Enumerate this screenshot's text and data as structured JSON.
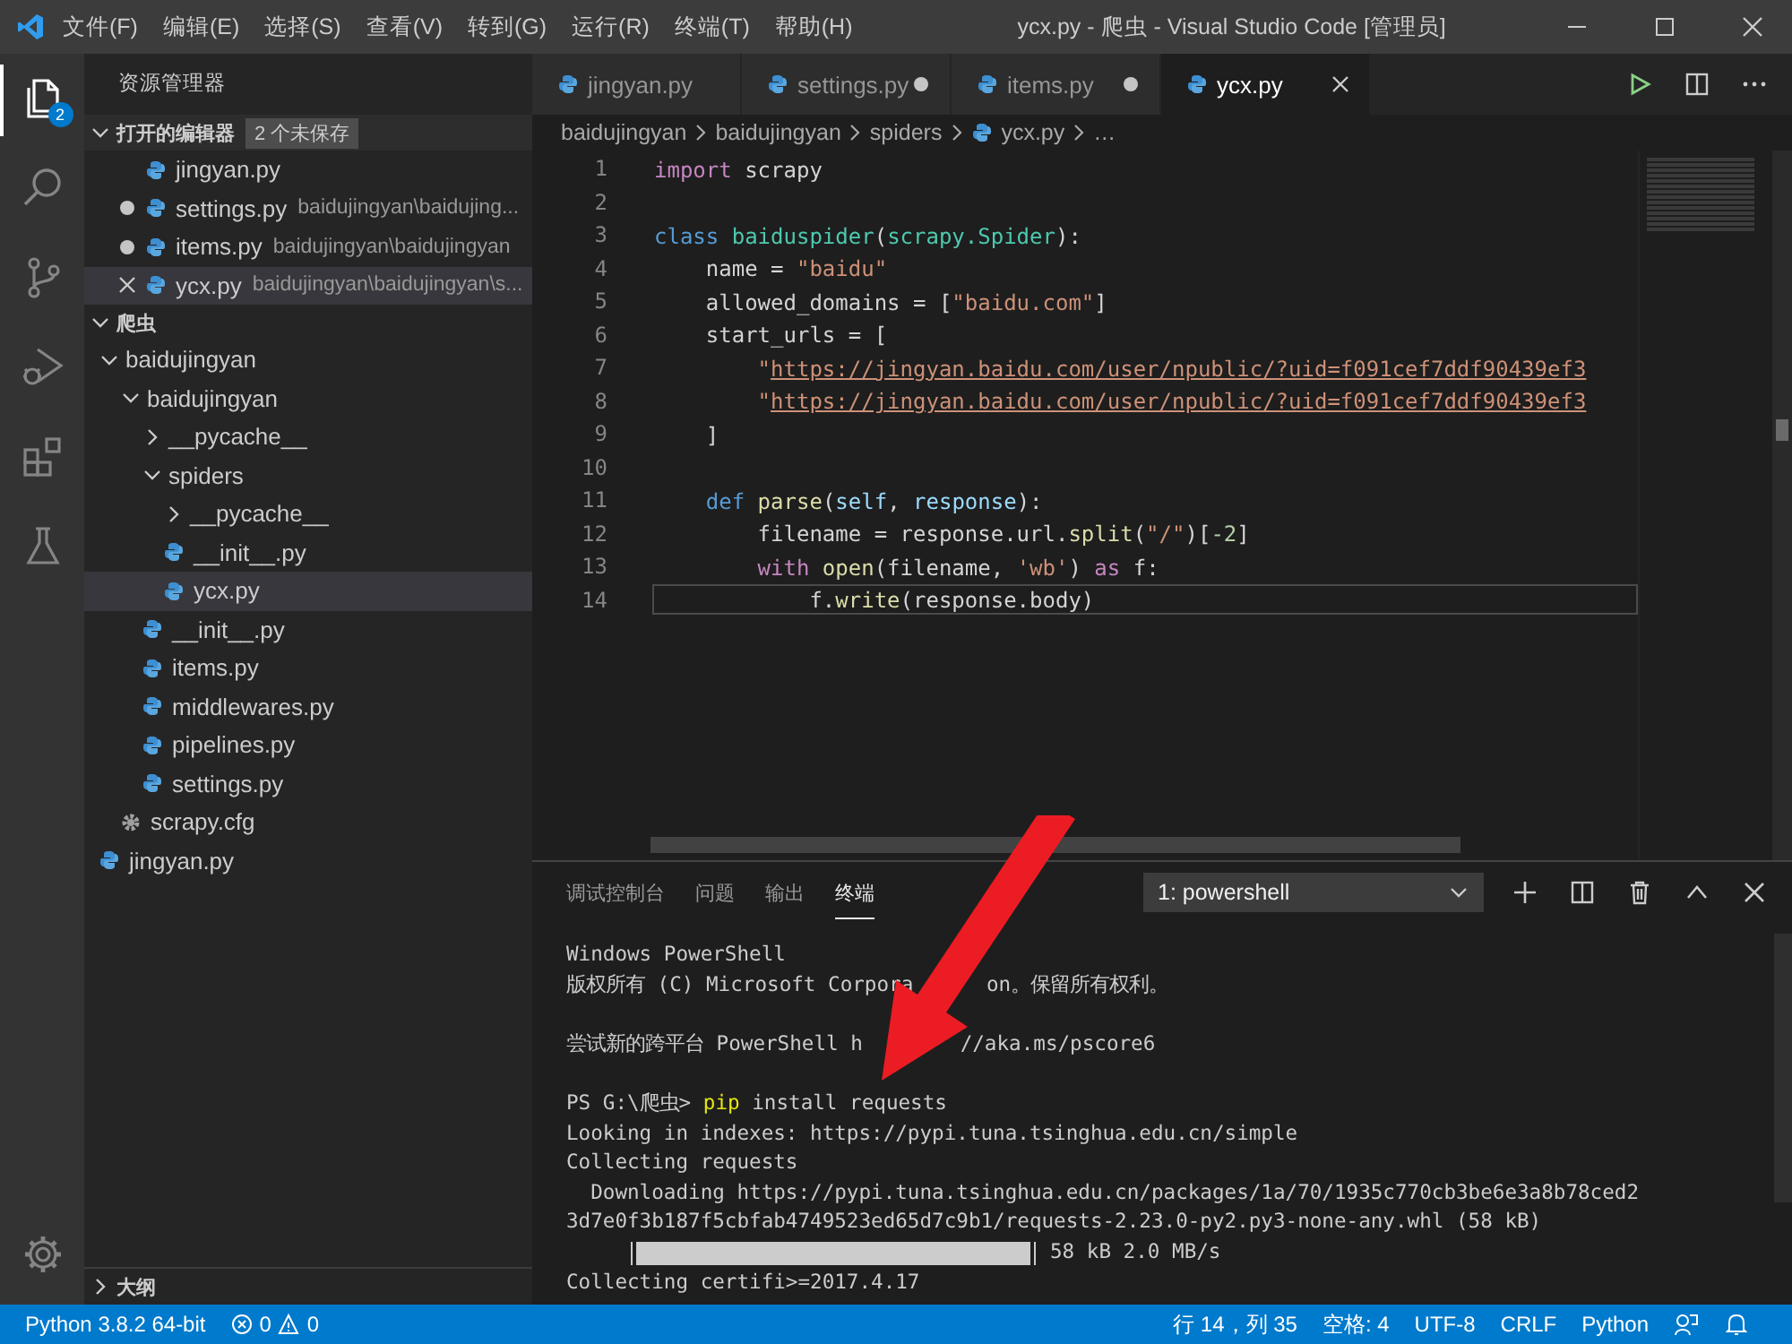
{
  "window": {
    "title": "ycx.py - 爬虫 - Visual Studio Code [管理员]"
  },
  "menu": [
    "文件(F)",
    "编辑(E)",
    "选择(S)",
    "查看(V)",
    "转到(G)",
    "运行(R)",
    "终端(T)",
    "帮助(H)"
  ],
  "activity_bar": {
    "explorer_badge": "2"
  },
  "sidebar": {
    "title": "资源管理器",
    "open_editors": {
      "label": "打开的编辑器",
      "badge": "2 个未保存",
      "expanded": true,
      "items": [
        {
          "label": "jingyan.py",
          "modified": false,
          "selected": false
        },
        {
          "label": "settings.py",
          "path": "baidujingyan\\baidujing...",
          "modified": true,
          "selected": false
        },
        {
          "label": "items.py",
          "path": "baidujingyan\\baidujingyan",
          "modified": true,
          "selected": false
        },
        {
          "label": "ycx.py",
          "path": "baidujingyan\\baidujingyan\\s...",
          "modified": false,
          "selected": true
        }
      ]
    },
    "workspace": {
      "label": "爬虫",
      "expanded": true,
      "tree": [
        {
          "label": "baidujingyan",
          "kind": "folder",
          "expanded": true,
          "selected": false,
          "children": [
            {
              "label": "baidujingyan",
              "kind": "folder",
              "expanded": true,
              "selected": false,
              "children": [
                {
                  "label": "__pycache__",
                  "kind": "folder",
                  "expanded": false,
                  "selected": false
                },
                {
                  "label": "spiders",
                  "kind": "folder",
                  "expanded": true,
                  "selected": false,
                  "children": [
                    {
                      "label": "__pycache__",
                      "kind": "folder",
                      "expanded": false,
                      "selected": false
                    },
                    {
                      "label": "__init__.py",
                      "kind": "python",
                      "selected": false
                    },
                    {
                      "label": "ycx.py",
                      "kind": "python",
                      "selected": true
                    }
                  ]
                },
                {
                  "label": "__init__.py",
                  "kind": "python",
                  "selected": false
                },
                {
                  "label": "items.py",
                  "kind": "python",
                  "selected": false
                },
                {
                  "label": "middlewares.py",
                  "kind": "python",
                  "selected": false
                },
                {
                  "label": "pipelines.py",
                  "kind": "python",
                  "selected": false
                },
                {
                  "label": "settings.py",
                  "kind": "python",
                  "selected": false
                }
              ]
            },
            {
              "label": "scrapy.cfg",
              "kind": "config",
              "selected": false
            }
          ]
        },
        {
          "label": "jingyan.py",
          "kind": "python",
          "selected": false
        }
      ]
    },
    "outline": {
      "label": "大纲",
      "expanded": false
    }
  },
  "tabs": [
    {
      "label": "jingyan.py",
      "modified": false,
      "selected": false
    },
    {
      "label": "settings.py",
      "modified": true,
      "selected": false
    },
    {
      "label": "items.py",
      "modified": true,
      "selected": false
    },
    {
      "label": "ycx.py",
      "modified": false,
      "selected": true
    }
  ],
  "breadcrumbs": [
    {
      "label": "baidujingyan",
      "kind": "folder"
    },
    {
      "label": "baidujingyan",
      "kind": "folder"
    },
    {
      "label": "spiders",
      "kind": "folder"
    },
    {
      "label": "ycx.py",
      "kind": "python"
    },
    {
      "label": "…",
      "kind": "symbol"
    }
  ],
  "editor": {
    "lines": [
      {
        "number": "1",
        "current": false,
        "tokens": [
          {
            "kind": "kw",
            "text": "import"
          },
          {
            "kind": "p",
            "text": " scrapy"
          }
        ]
      },
      {
        "number": "2",
        "current": false
      },
      {
        "number": "3",
        "current": false,
        "tokens": [
          {
            "kind": "st",
            "text": "class"
          },
          {
            "kind": "cls",
            "text": " baiduspider"
          },
          {
            "kind": "p",
            "text": "("
          },
          {
            "kind": "cls",
            "text": "scrapy.Spider"
          },
          {
            "kind": "p",
            "text": "):"
          }
        ]
      },
      {
        "number": "4",
        "current": false,
        "tokens": [
          {
            "kind": "p",
            "text": "    name = "
          },
          {
            "kind": "s",
            "text": "\"baidu\""
          }
        ]
      },
      {
        "number": "5",
        "current": false,
        "tokens": [
          {
            "kind": "p",
            "text": "    allowed_domains = ["
          },
          {
            "kind": "s",
            "text": "\"baidu.com\""
          },
          {
            "kind": "p",
            "text": "]"
          }
        ]
      },
      {
        "number": "6",
        "current": false,
        "tokens": [
          {
            "kind": "p",
            "text": "    start_urls = ["
          }
        ]
      },
      {
        "number": "7",
        "current": false,
        "tokens": [
          {
            "kind": "s",
            "text": "        \""
          },
          {
            "kind": "u",
            "text": "https://jingyan.baidu.com/user/npublic/?uid=f091cef7ddf90439ef3"
          }
        ]
      },
      {
        "number": "8",
        "current": false,
        "tokens": [
          {
            "kind": "s",
            "text": "        \""
          },
          {
            "kind": "u",
            "text": "https://jingyan.baidu.com/user/npublic/?uid=f091cef7ddf90439ef3"
          }
        ]
      },
      {
        "number": "9",
        "current": false,
        "tokens": [
          {
            "kind": "p",
            "text": "    ]"
          }
        ]
      },
      {
        "number": "10",
        "current": false
      },
      {
        "number": "11",
        "current": false,
        "tokens": [
          {
            "kind": "st",
            "text": "    def"
          },
          {
            "kind": "fn",
            "text": " parse"
          },
          {
            "kind": "p",
            "text": "("
          },
          {
            "kind": "par",
            "text": "self"
          },
          {
            "kind": "p",
            "text": ", "
          },
          {
            "kind": "par",
            "text": "response"
          },
          {
            "kind": "p",
            "text": "):"
          }
        ]
      },
      {
        "number": "12",
        "current": false,
        "tokens": [
          {
            "kind": "p",
            "text": "        filename = response.url."
          },
          {
            "kind": "fn",
            "text": "split"
          },
          {
            "kind": "p",
            "text": "("
          },
          {
            "kind": "s",
            "text": "\"/\""
          },
          {
            "kind": "p",
            "text": ")["
          },
          {
            "kind": "n",
            "text": "-2"
          },
          {
            "kind": "p",
            "text": "]"
          }
        ]
      },
      {
        "number": "13",
        "current": false,
        "tokens": [
          {
            "kind": "kw",
            "text": "        with"
          },
          {
            "kind": "fn",
            "text": " open"
          },
          {
            "kind": "p",
            "text": "(filename, "
          },
          {
            "kind": "s",
            "text": "'wb'"
          },
          {
            "kind": "p",
            "text": ") "
          },
          {
            "kind": "kw",
            "text": "as"
          },
          {
            "kind": "p",
            "text": " f:"
          }
        ]
      },
      {
        "number": "14",
        "current": true,
        "tokens": [
          {
            "kind": "p",
            "text": "            f."
          },
          {
            "kind": "fn",
            "text": "write"
          },
          {
            "kind": "p",
            "text": "(response.body)"
          }
        ]
      }
    ]
  },
  "panel": {
    "tabs": [
      {
        "label": "调试控制台",
        "selected": false
      },
      {
        "label": "问题",
        "selected": false
      },
      {
        "label": "输出",
        "selected": false
      },
      {
        "label": "终端",
        "selected": true
      }
    ],
    "terminal_select": "1: powershell",
    "lines": [
      {
        "kind": "text",
        "parts": [
          {
            "kind": "p",
            "text": "Windows PowerShell"
          }
        ]
      },
      {
        "kind": "text",
        "parts": [
          {
            "kind": "p",
            "text": "版权所有 (C) Microsoft Corpora"
          },
          {
            "kind": "p",
            "text": "      on。保留所有权利。"
          }
        ]
      },
      {
        "kind": "blank"
      },
      {
        "kind": "text",
        "parts": [
          {
            "kind": "p",
            "text": "尝试新的跨平台 PowerShell h"
          },
          {
            "kind": "p",
            "text": "        //aka.ms/pscore6"
          }
        ]
      },
      {
        "kind": "blank"
      },
      {
        "kind": "text",
        "parts": [
          {
            "kind": "p",
            "text": "PS G:\\爬虫> "
          },
          {
            "kind": "cmd",
            "text": "pip"
          },
          {
            "kind": "p",
            "text": " install requests"
          }
        ]
      },
      {
        "kind": "text",
        "parts": [
          {
            "kind": "p",
            "text": "Looking in indexes: https://pypi.tuna.tsinghua.edu.cn/simple"
          }
        ]
      },
      {
        "kind": "text",
        "parts": [
          {
            "kind": "p",
            "text": "Collecting requests"
          }
        ]
      },
      {
        "kind": "text",
        "parts": [
          {
            "kind": "p",
            "text": "  Downloading https://pypi.tuna.tsinghua.edu.cn/packages/1a/70/1935c770cb3be6e3a8b78ced2"
          }
        ]
      },
      {
        "kind": "text",
        "parts": [
          {
            "kind": "p",
            "text": "3d7e0f3b187f5cbfab4749523ed65d7c9b1/requests-2.23.0-py2.py3-none-any.whl (58 kB)"
          }
        ]
      },
      {
        "kind": "progress",
        "level": 1,
        "reading": "58 kB 2.0 MB/s"
      },
      {
        "kind": "text",
        "parts": [
          {
            "kind": "p",
            "text": "Collecting certifi>=2017.4.17"
          }
        ]
      }
    ]
  },
  "status_bar": {
    "interpreter": "Python 3.8.2 64-bit",
    "errors": "0",
    "warnings": "0",
    "items": [
      "行 14，列 35",
      "空格: 4",
      "UTF-8",
      "CRLF",
      "Python"
    ]
  }
}
